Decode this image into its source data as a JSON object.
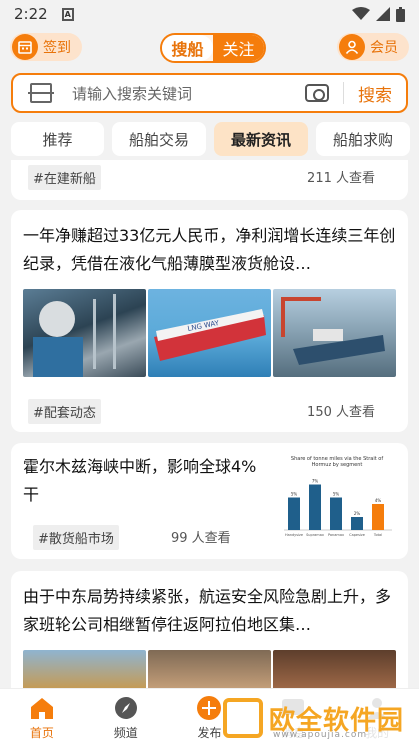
{
  "status_bar": {
    "time": "2:22",
    "notification_icon": "A"
  },
  "header": {
    "signin_label": "签到",
    "toggle": [
      "搜船",
      "关注"
    ],
    "member_label": "会员"
  },
  "search": {
    "placeholder": "请输入搜索关键词",
    "button": "搜索"
  },
  "tabs": [
    "推荐",
    "船舶交易",
    "最新资讯",
    "船舶求购"
  ],
  "active_tab": 2,
  "feed": [
    {
      "tag": "#在建新船",
      "views": "211 人查看"
    },
    {
      "title": "一年净赚超过33亿元人民币，净利润增长连续三年创纪录，凭借在液化气船薄膜型液货舱设…",
      "tag": "#配套动态",
      "views": "150 人查看"
    },
    {
      "title": "霍尔木兹海峡中断，影响全球4%干",
      "tag": "#散货船市场",
      "views": "99 人查看",
      "chart_data": {
        "type": "bar",
        "title": "Share of tonne miles via the Strait of Hormuz by segment",
        "categories": [
          "Handysize",
          "Supramax",
          "Panamax",
          "Capesize",
          "Total"
        ],
        "values": [
          5,
          7,
          5,
          2,
          4
        ],
        "value_labels": [
          "5%",
          "7%",
          "5%",
          "2%",
          "4%"
        ],
        "colors": [
          "#1f5f8b",
          "#1f5f8b",
          "#1f5f8b",
          "#1f5f8b",
          "#f57d0c"
        ]
      }
    },
    {
      "title": "由于中东局势持续紧张，航运安全风险急剧上升，多家班轮公司相继暂停往返阿拉伯地区集…"
    }
  ],
  "bottom_nav": [
    "首页",
    "频道",
    "发布",
    "消息",
    "我的"
  ],
  "watermark": {
    "text": "欧全软件园",
    "url": "www.apoujia.com"
  },
  "colors": {
    "accent": "#f57d0c",
    "accent_light": "#fde3cc",
    "background": "#f2f2f2"
  }
}
